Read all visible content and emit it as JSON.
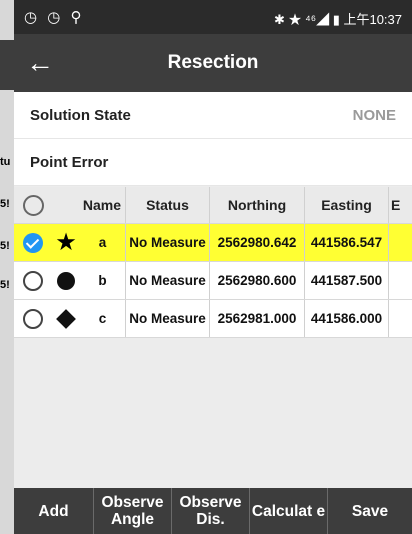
{
  "status_bar": {
    "left_icons": "◷ ◷ ⚲",
    "right": "✱ ★ ⁴⁶◢ ▮ 上午10:37"
  },
  "background": {
    "row_fragments": [
      "tu",
      "5!",
      "5!",
      "5!"
    ]
  },
  "header": {
    "back_icon": "←",
    "title": "Resection"
  },
  "solution_state": {
    "label": "Solution State",
    "value": "NONE"
  },
  "point_error": {
    "label": "Point Error"
  },
  "table": {
    "columns": [
      "Name",
      "Status",
      "Northing",
      "Easting",
      "E"
    ],
    "rows": [
      {
        "checked": true,
        "symbol": "star",
        "name": "a",
        "status": "No Measure",
        "northing": "2562980.642",
        "easting": "441586.547"
      },
      {
        "checked": false,
        "symbol": "circle",
        "name": "b",
        "status": "No Measure",
        "northing": "2562980.600",
        "easting": "441587.500"
      },
      {
        "checked": false,
        "symbol": "diamond",
        "name": "c",
        "status": "No Measure",
        "northing": "2562981.000",
        "easting": "441586.000"
      }
    ]
  },
  "toolbar": {
    "add": "Add",
    "observe_angle": "Observe Angle",
    "observe_dis": "Observe Dis.",
    "calculate": "Calculat e",
    "save": "Save"
  }
}
